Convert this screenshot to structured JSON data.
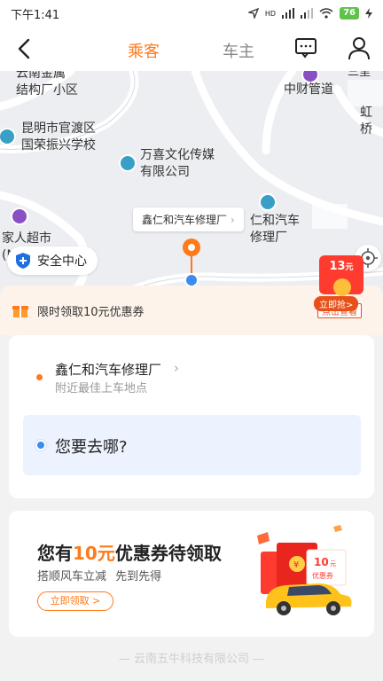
{
  "status_bar": {
    "time": "下午1:41",
    "network_label": "HD",
    "battery_level": "76"
  },
  "header": {
    "tabs": [
      {
        "label": "乘客",
        "active": true
      },
      {
        "label": "车主",
        "active": false
      }
    ],
    "icons": [
      "back-arrow-icon",
      "message-icon",
      "user-icon"
    ]
  },
  "map": {
    "labels": {
      "top_left": "云南金属\n结构厂小区",
      "top_right_partial": "三里",
      "zhongcai": "中财管道",
      "hongzhuan": "虹桥",
      "school": "昆明市官渡区\n国荣振兴学校",
      "wanxi": "万喜文化传媒\n有限公司",
      "renhe": "仁和汽车\n修理厂",
      "supermarket": "家人超市\n(N"
    },
    "callout_text": "鑫仁和汽车修理厂",
    "safety_center_label": "安全中心"
  },
  "red_packet": {
    "amount": "13",
    "unit": "元",
    "grab_label": "立即抢>",
    "view_label": "点击查看"
  },
  "coupon_banner": {
    "text": "限时领取10元优惠券"
  },
  "route": {
    "origin_name": "鑫仁和汽车修理厂",
    "origin_hint": "附近最佳上车地点",
    "destination_placeholder": "您要去哪?"
  },
  "promo": {
    "title_prefix": "您有",
    "title_amount": "10元",
    "title_suffix": "优惠券待领取",
    "subtitle": "搭顺风车立减 先到先得",
    "button_label": "立即领取 >",
    "art_amount": "10",
    "art_unit": "元",
    "art_label": "优惠券"
  },
  "footer": {
    "text": "— 云南五牛科技有限公司 —"
  },
  "colors": {
    "accent_orange": "#ff7a1a",
    "destination_blue": "#3c8bf0",
    "safety_blue": "#1f6fe0",
    "red_packet": "#ff3b30"
  }
}
